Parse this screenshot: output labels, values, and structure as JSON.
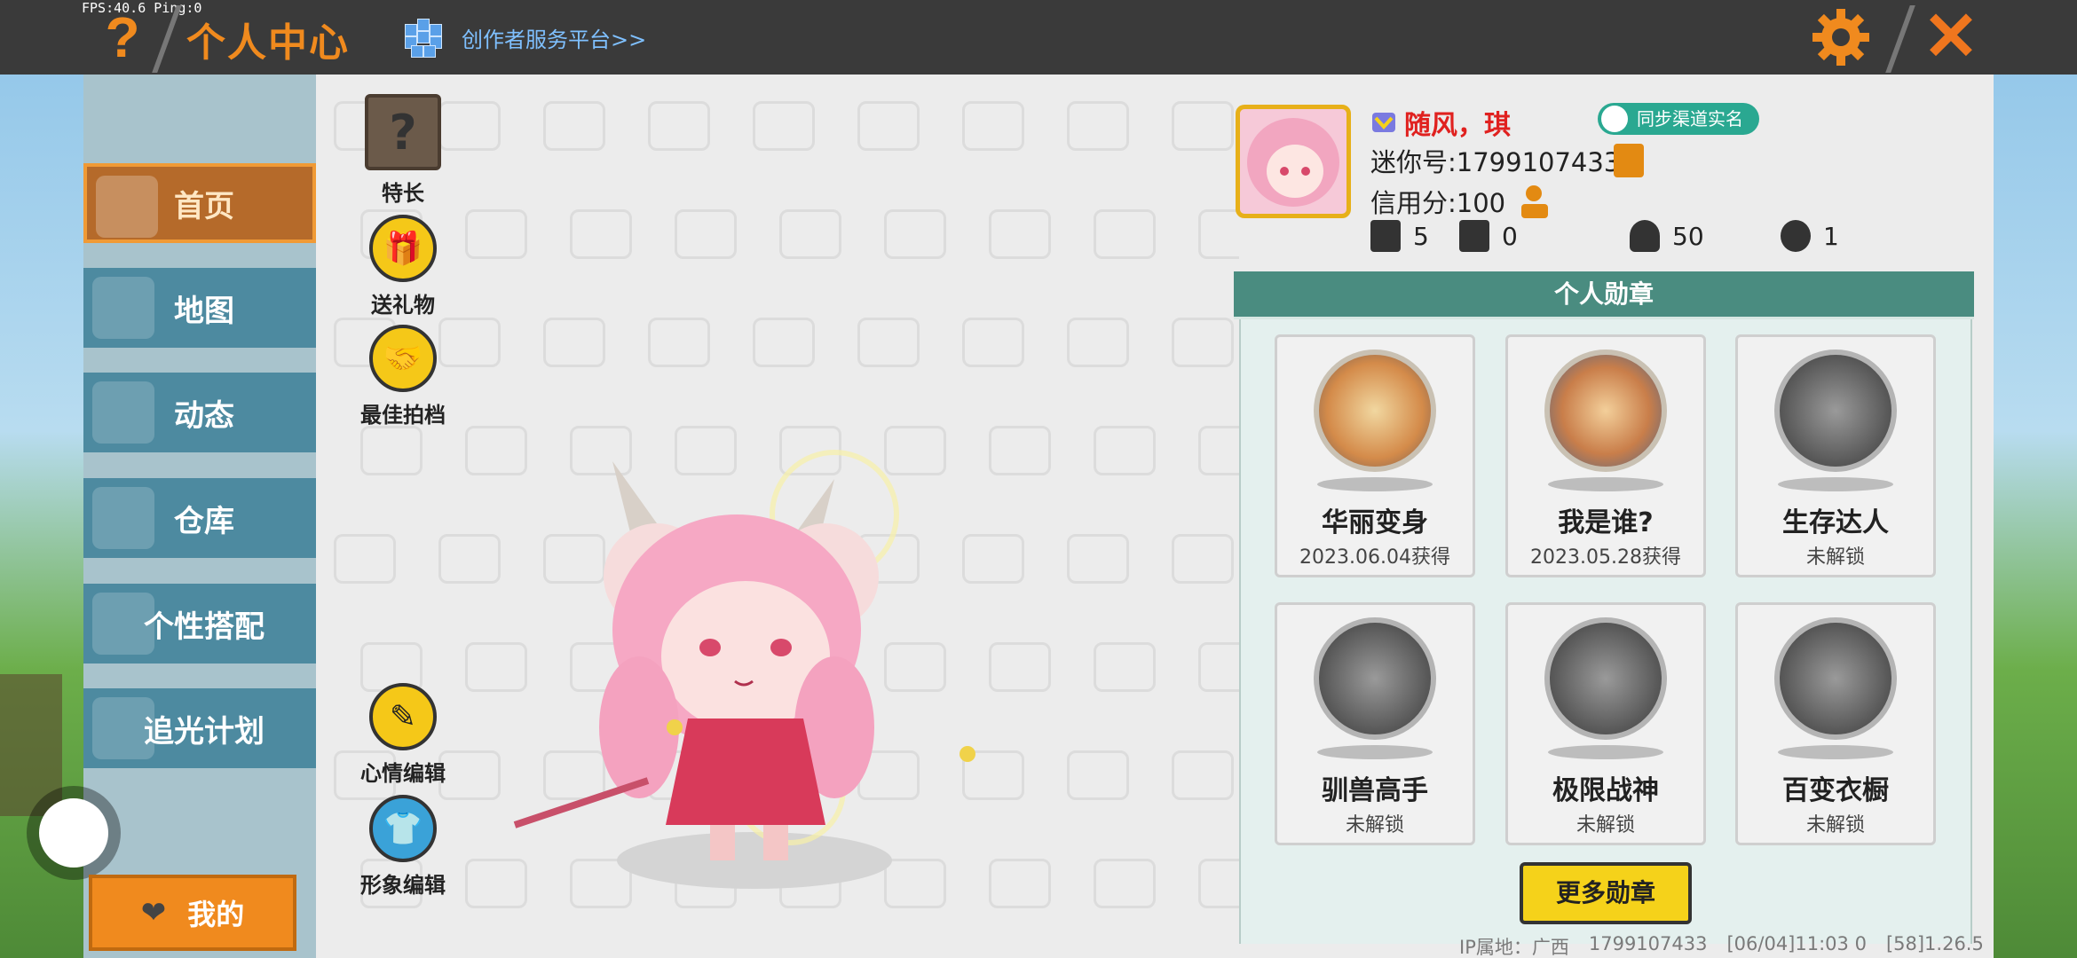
{
  "hud": {
    "fps_text": "FPS:40.6  Ping:0"
  },
  "header": {
    "help_symbol": "?",
    "title": "个人中心",
    "creator_link": "创作者服务平台>>",
    "close_symbol": "✕"
  },
  "sidebar": {
    "items": [
      {
        "label": "首页",
        "active": true
      },
      {
        "label": "地图"
      },
      {
        "label": "动态"
      },
      {
        "label": "仓库"
      },
      {
        "label": "个性搭配"
      },
      {
        "label": "追光计划"
      }
    ],
    "me_label": "我的"
  },
  "actions": {
    "specialty": "特长",
    "specialty_symbol": "?",
    "gift": "送礼物",
    "partner": "最佳拍档",
    "mood": "心情编辑",
    "look": "形象编辑"
  },
  "profile": {
    "name": "随风，琪",
    "sync_label": "同步渠道实名",
    "mini_id": "迷你号:1799107433",
    "credit": "信用分:100",
    "stats": [
      {
        "icon": "bookmark-plus-icon",
        "value": "5"
      },
      {
        "icon": "fans-icon",
        "value": "0"
      },
      {
        "icon": "flame-icon",
        "value": "50"
      },
      {
        "icon": "heart-icon",
        "value": "1"
      }
    ]
  },
  "medals": {
    "title": "个人勋章",
    "items": [
      {
        "name": "华丽变身",
        "status": "2023.06.04获得",
        "unlocked": true
      },
      {
        "name": "我是谁?",
        "status": "2023.05.28获得",
        "unlocked": true
      },
      {
        "name": "生存达人",
        "status": "未解锁",
        "unlocked": false
      },
      {
        "name": "驯兽高手",
        "status": "未解锁",
        "unlocked": false
      },
      {
        "name": "极限战神",
        "status": "未解锁",
        "unlocked": false
      },
      {
        "name": "百变衣橱",
        "status": "未解锁",
        "unlocked": false
      }
    ],
    "more_label": "更多勋章"
  },
  "footer": {
    "ip": "IP属地：广西",
    "uid": "1799107433",
    "time": "[06/04]11:03 0",
    "version": "[58]1.26.5"
  },
  "colors": {
    "accent": "#f08a1e",
    "nav": "#4d8aa0",
    "medal_header": "#4a8c80",
    "name": "#e0211f"
  }
}
